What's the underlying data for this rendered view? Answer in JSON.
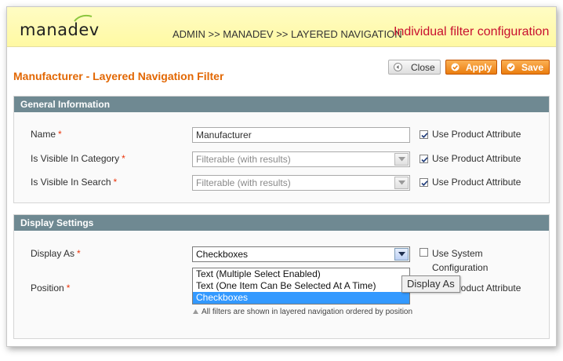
{
  "header": {
    "logo_text": "manadev",
    "breadcrumb": "ADMIN >> MANADEV >> LAYERED NAVIGATION",
    "caption": "Individual filter configuration"
  },
  "page": {
    "title": "Manufacturer - Layered Navigation Filter",
    "buttons": {
      "close": "Close",
      "apply": "Apply",
      "save": "Save"
    }
  },
  "general": {
    "heading": "General Information",
    "fields": [
      {
        "label": "Name",
        "required": "*",
        "value": "Manufacturer",
        "checkbox_label": "Use Product Attribute",
        "checked": true
      },
      {
        "label": "Is Visible In Category",
        "required": "*",
        "value": "Filterable (with results)",
        "checkbox_label": "Use Product Attribute",
        "checked": true
      },
      {
        "label": "Is Visible In Search",
        "required": "*",
        "value": "Filterable (with results)",
        "checkbox_label": "Use Product Attribute",
        "checked": true
      }
    ]
  },
  "display": {
    "heading": "Display Settings",
    "display_as": {
      "label": "Display As",
      "required": "*",
      "value": "Checkboxes",
      "options": [
        "Text (Multiple Select Enabled)",
        "Text (One Item Can Be Selected At A Time)",
        "Checkboxes"
      ],
      "selected_index": 2,
      "checkbox_label_line1": "Use System",
      "checkbox_label_line2": "Configuration",
      "checked": false
    },
    "tooltip": "Display As",
    "position": {
      "label": "Position",
      "required": "*",
      "checkbox_label": "Use Product Attribute",
      "checked": true,
      "note": "All filters are shown in layered navigation ordered by position"
    }
  },
  "colors": {
    "accent": "#e26703",
    "caption": "#c8102e",
    "section_header": "#6f8992",
    "selection": "#3399ff"
  }
}
